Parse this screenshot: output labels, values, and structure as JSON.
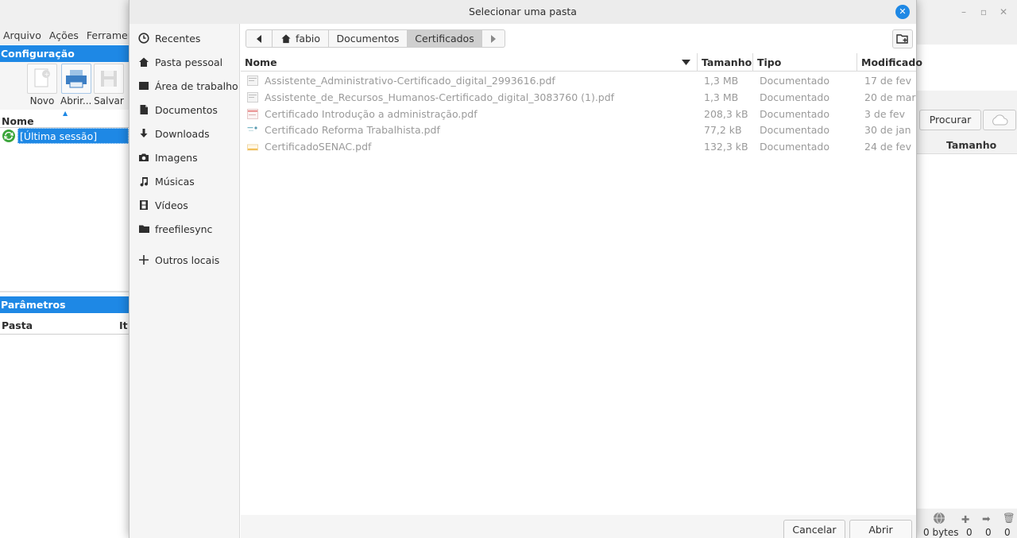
{
  "background_app": {
    "menu": [
      "Arquivo",
      "Ações",
      "Ferramentas"
    ],
    "config_panel": {
      "title": "Configuração",
      "tools": [
        {
          "label": "Novo"
        },
        {
          "label": "Abrir..."
        },
        {
          "label": "Salvar"
        }
      ],
      "list_header": "Nome",
      "session_item": "[Última sessão]"
    },
    "params_panel": {
      "title": "Parâmetros",
      "col_pasta": "Pasta",
      "col_item": "It"
    },
    "right": {
      "browse_button": "Procurar",
      "col_size": "Tamanho",
      "status_bytes": "0 bytes",
      "status_counts": [
        "0",
        "0",
        "0"
      ]
    }
  },
  "dialog": {
    "title": "Selecionar uma pasta",
    "places": [
      {
        "label": "Recentes",
        "icon": "clock-icon"
      },
      {
        "label": "Pasta pessoal",
        "icon": "home-icon"
      },
      {
        "label": "Área de trabalho",
        "icon": "desktop-icon"
      },
      {
        "label": "Documentos",
        "icon": "document-icon"
      },
      {
        "label": "Downloads",
        "icon": "download-icon"
      },
      {
        "label": "Imagens",
        "icon": "camera-icon"
      },
      {
        "label": "Músicas",
        "icon": "music-icon"
      },
      {
        "label": "Vídeos",
        "icon": "film-icon"
      },
      {
        "label": "freefilesync",
        "icon": "folder-icon"
      },
      {
        "label": "Outros locais",
        "icon": "plus-icon"
      }
    ],
    "path": [
      "fabio",
      "Documentos",
      "Certificados"
    ],
    "columns": {
      "name": "Nome",
      "size": "Tamanho",
      "type": "Tipo",
      "modified": "Modificado"
    },
    "files": [
      {
        "name": "Assistente_Administrativo-Certificado_digital_2993616.pdf",
        "size": "1,3 MB",
        "type": "Documentado",
        "modified": "17 de fev"
      },
      {
        "name": "Assistente_de_Recursos_Humanos-Certificado_digital_3083760 (1).pdf",
        "size": "1,3 MB",
        "type": "Documentado",
        "modified": "20 de mar"
      },
      {
        "name": "Certificado Introdução a administração.pdf",
        "size": "208,3 kB",
        "type": "Documentado",
        "modified": "3 de fev"
      },
      {
        "name": "Certificado Reforma Trabalhista.pdf",
        "size": "77,2 kB",
        "type": "Documentado",
        "modified": "30 de jan"
      },
      {
        "name": "CertificadoSENAC.pdf",
        "size": "132,3 kB",
        "type": "Documentado",
        "modified": "24 de fev"
      }
    ],
    "buttons": {
      "cancel": "Cancelar",
      "open": "Abrir"
    }
  },
  "colors": {
    "accent": "#1e88e5",
    "dimmed_text": "#9a9a9a"
  }
}
